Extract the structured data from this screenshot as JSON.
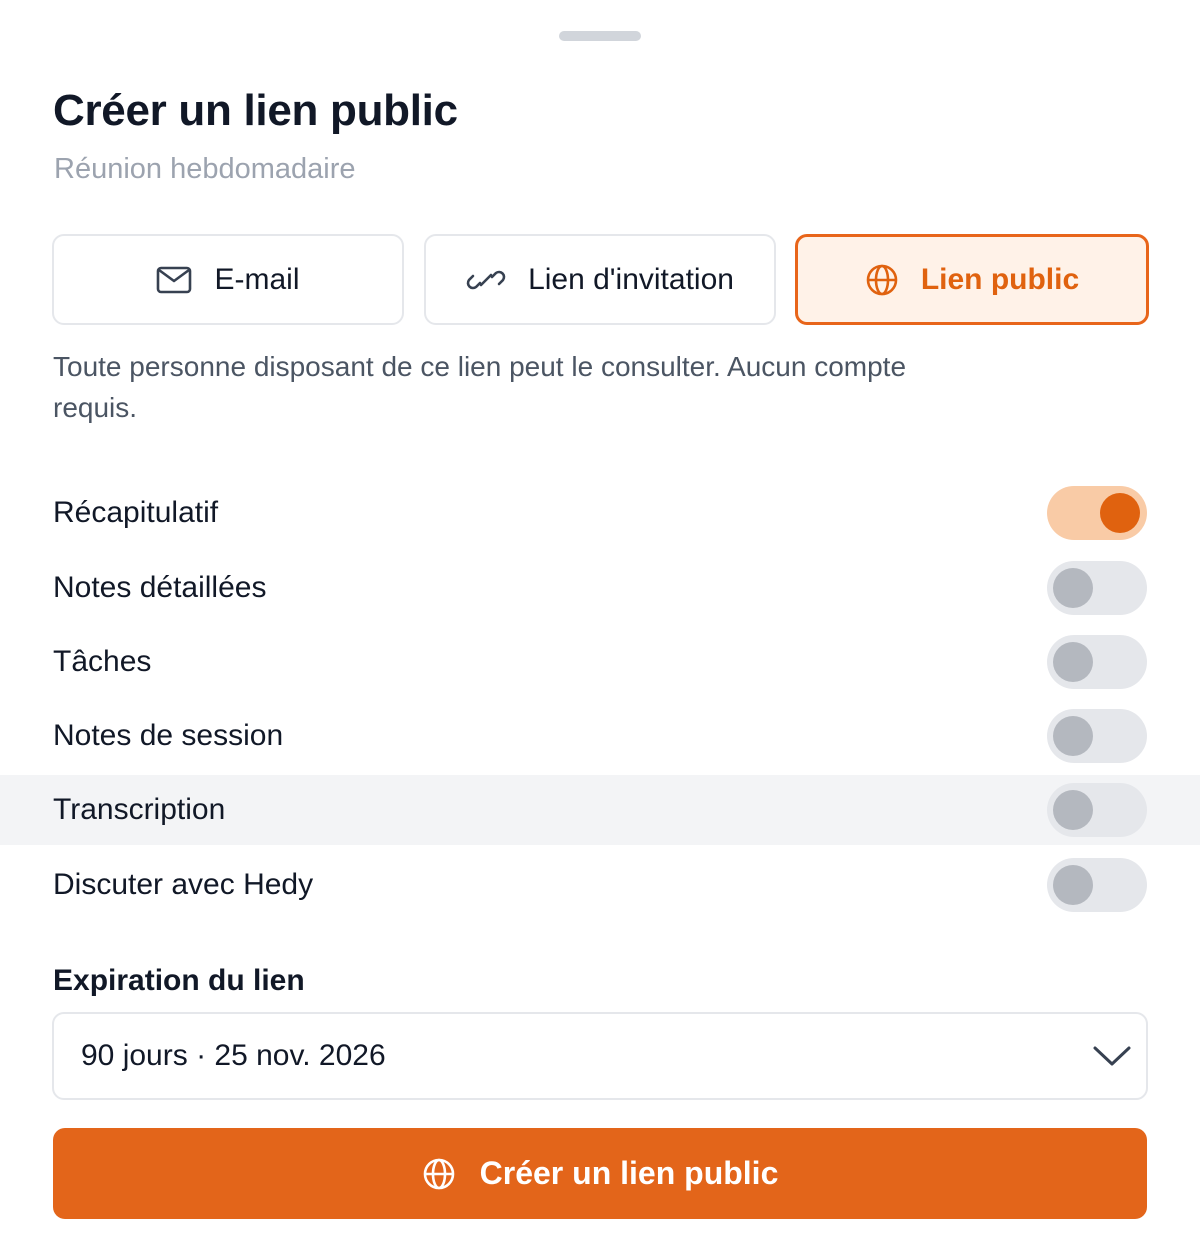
{
  "sheet": {
    "title": "Créer un lien public",
    "subtitle": "Réunion hebdomadaire"
  },
  "tabs": [
    {
      "label": "E-mail",
      "icon": "mail-icon",
      "selected": false
    },
    {
      "label": "Lien d'invitation",
      "icon": "link-icon",
      "selected": false
    },
    {
      "label": "Lien public",
      "icon": "globe-icon",
      "selected": true
    }
  ],
  "description": "Toute personne disposant de ce lien peut le consulter. Aucun compte requis.",
  "options": [
    {
      "label": "Récapitulatif",
      "enabled": true
    },
    {
      "label": "Notes détaillées",
      "enabled": false
    },
    {
      "label": "Tâches",
      "enabled": false
    },
    {
      "label": "Notes de session",
      "enabled": false
    },
    {
      "label": "Transcription",
      "enabled": false,
      "highlighted": true
    },
    {
      "label": "Discuter avec Hedy",
      "enabled": false
    }
  ],
  "expiration": {
    "label": "Expiration du lien",
    "selected_value": "90 jours · 25 nov. 2026"
  },
  "cta": {
    "label": "Créer un lien public",
    "icon": "globe-icon"
  },
  "colors": {
    "accent": "#e3651a",
    "accent_light": "#fff2e8",
    "toggle_on_track": "#f9cba6",
    "toggle_off_track": "#e5e7eb",
    "text_primary": "#111827",
    "text_muted": "#9ca3af"
  }
}
